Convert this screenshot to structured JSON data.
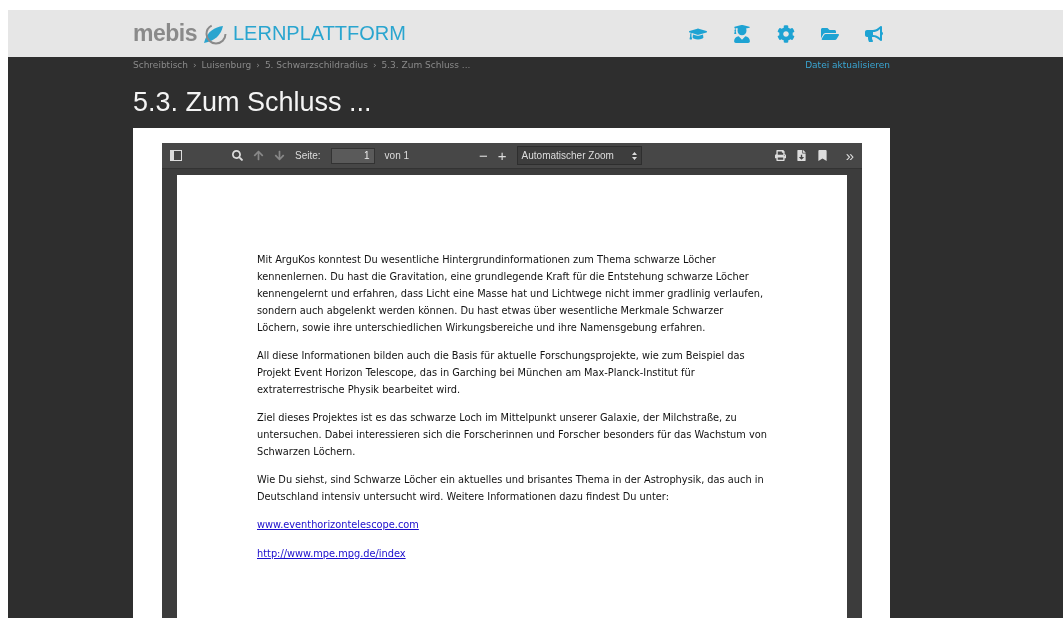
{
  "header": {
    "logo": "mebis",
    "platform": "LERNPLATTFORM"
  },
  "breadcrumb": [
    "Schreibtisch",
    "Luisenburg",
    "5. Schwarzschildradius",
    "5.3. Zum Schluss ..."
  ],
  "breadcrumb_separator": "›",
  "update_link": "Datei aktualisieren",
  "page_title": "5.3. Zum Schluss ...",
  "viewer": {
    "page_label": "Seite:",
    "page_value": "1",
    "page_total": "von 1",
    "minus": "−",
    "plus": "+",
    "zoom": "Automatischer Zoom",
    "more": "»"
  },
  "document": {
    "paragraphs": [
      {
        "kind": "text",
        "text": "Mit ArguKos konntest Du wesentliche Hintergrundinformationen zum Thema schwarze Löcher kennenlernen. Du hast die Gravitation, eine grundlegende Kraft für die Entstehung schwarze Löcher kennengelernt und erfahren, dass Licht eine Masse hat und Lichtwege nicht immer gradlinig verlaufen, sondern auch abgelenkt werden können. Du hast etwas über wesentliche Merkmale Schwarzer Löchern, sowie ihre unterschiedlichen Wirkungsbereiche und ihre Namensgebung erfahren."
      },
      {
        "kind": "text",
        "text": "All diese Informationen bilden auch die Basis für aktuelle Forschungsprojekte, wie zum Beispiel das Projekt Event Horizon Telescope, das in Garching bei München am Max-Planck-Institut für extraterrestrische Physik bearbeitet wird."
      },
      {
        "kind": "text",
        "text": "Ziel dieses Projektes ist es das schwarze Loch im Mittelpunkt unserer Galaxie, der Milchstraße, zu untersuchen. Dabei interessieren sich die Forscherinnen und Forscher besonders für das Wachstum von Schwarzen Löchern."
      },
      {
        "kind": "text",
        "text": "Wie Du siehst, sind Schwarze Löcher ein aktuelles und brisantes Thema in der Astrophysik, das auch in Deutschland intensiv untersucht wird. Weitere Informationen dazu findest Du unter:"
      },
      {
        "kind": "link",
        "text": "www.eventhorizontelescope.com"
      },
      {
        "kind": "link",
        "text": "http://www.mpe.mpg.de/index"
      }
    ]
  }
}
